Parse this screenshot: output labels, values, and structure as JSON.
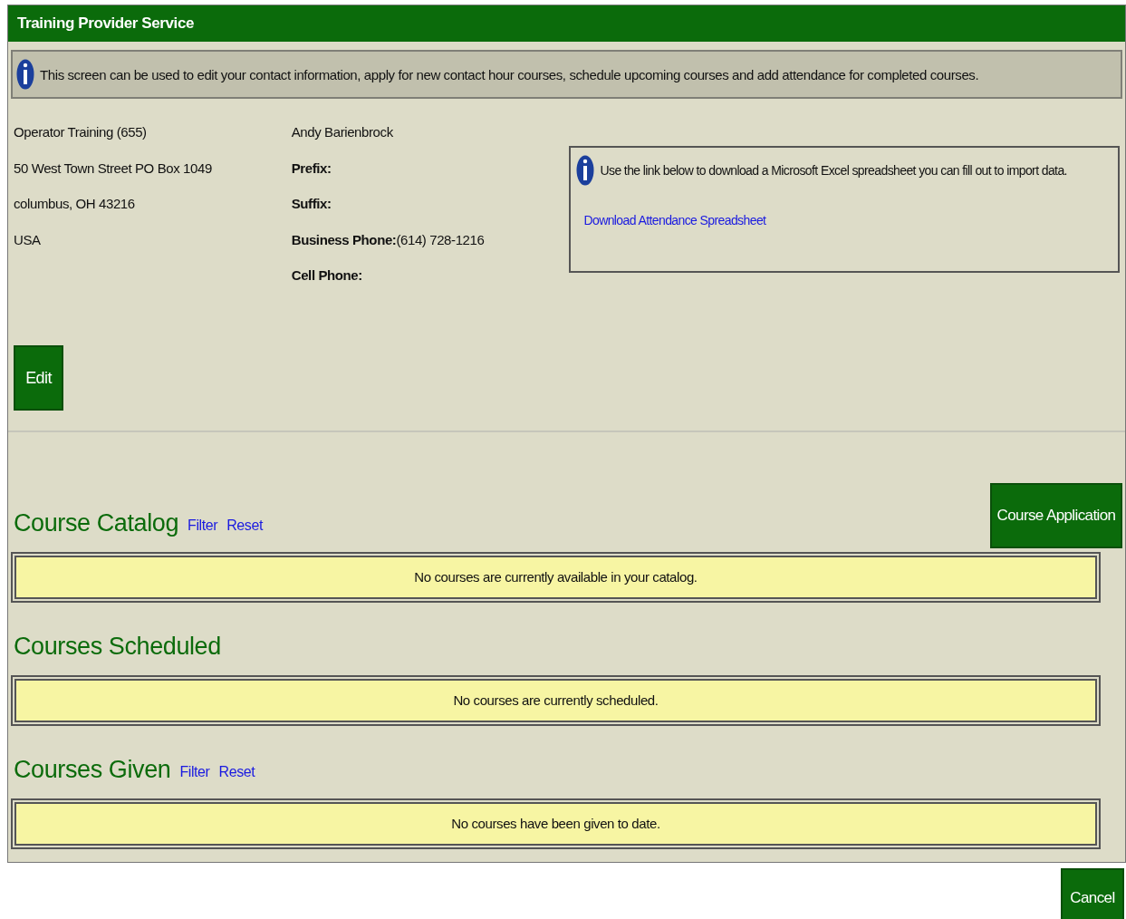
{
  "window": {
    "title": "Training Provider Service"
  },
  "info_bar": {
    "text": "This screen can be used to edit your contact information, apply for new contact hour courses, schedule upcoming courses and add attendance for completed courses."
  },
  "address": [
    "Operator Training (655)",
    "50 West Town Street PO Box 1049",
    "columbus,  OH  43216",
    "USA"
  ],
  "contact": {
    "name": "Andy Barienbrock",
    "fields": [
      {
        "label": "Prefix:"
      },
      {
        "label": "Suffix:"
      },
      {
        "label": "Business Phone:",
        "value": "(614) 728-1216"
      },
      {
        "label": "Cell Phone:"
      }
    ]
  },
  "download_box": {
    "text": "Use the link below to download a Microsoft Excel spreadsheet you can fill out to import data.",
    "link": "Download Attendance Spreadsheet"
  },
  "edit_button": "Edit",
  "sections": [
    {
      "title": "Course Catalog",
      "links": [
        "Filter",
        "Reset"
      ],
      "button": "Course Application",
      "message": "No courses are currently available in your catalog."
    },
    {
      "title": "Courses Scheduled",
      "message": "No courses are currently scheduled."
    },
    {
      "title": "Courses Given",
      "links": [
        "Filter",
        "Reset"
      ],
      "message": "No courses have been given to date."
    }
  ],
  "cancel_button": "Cancel"
}
